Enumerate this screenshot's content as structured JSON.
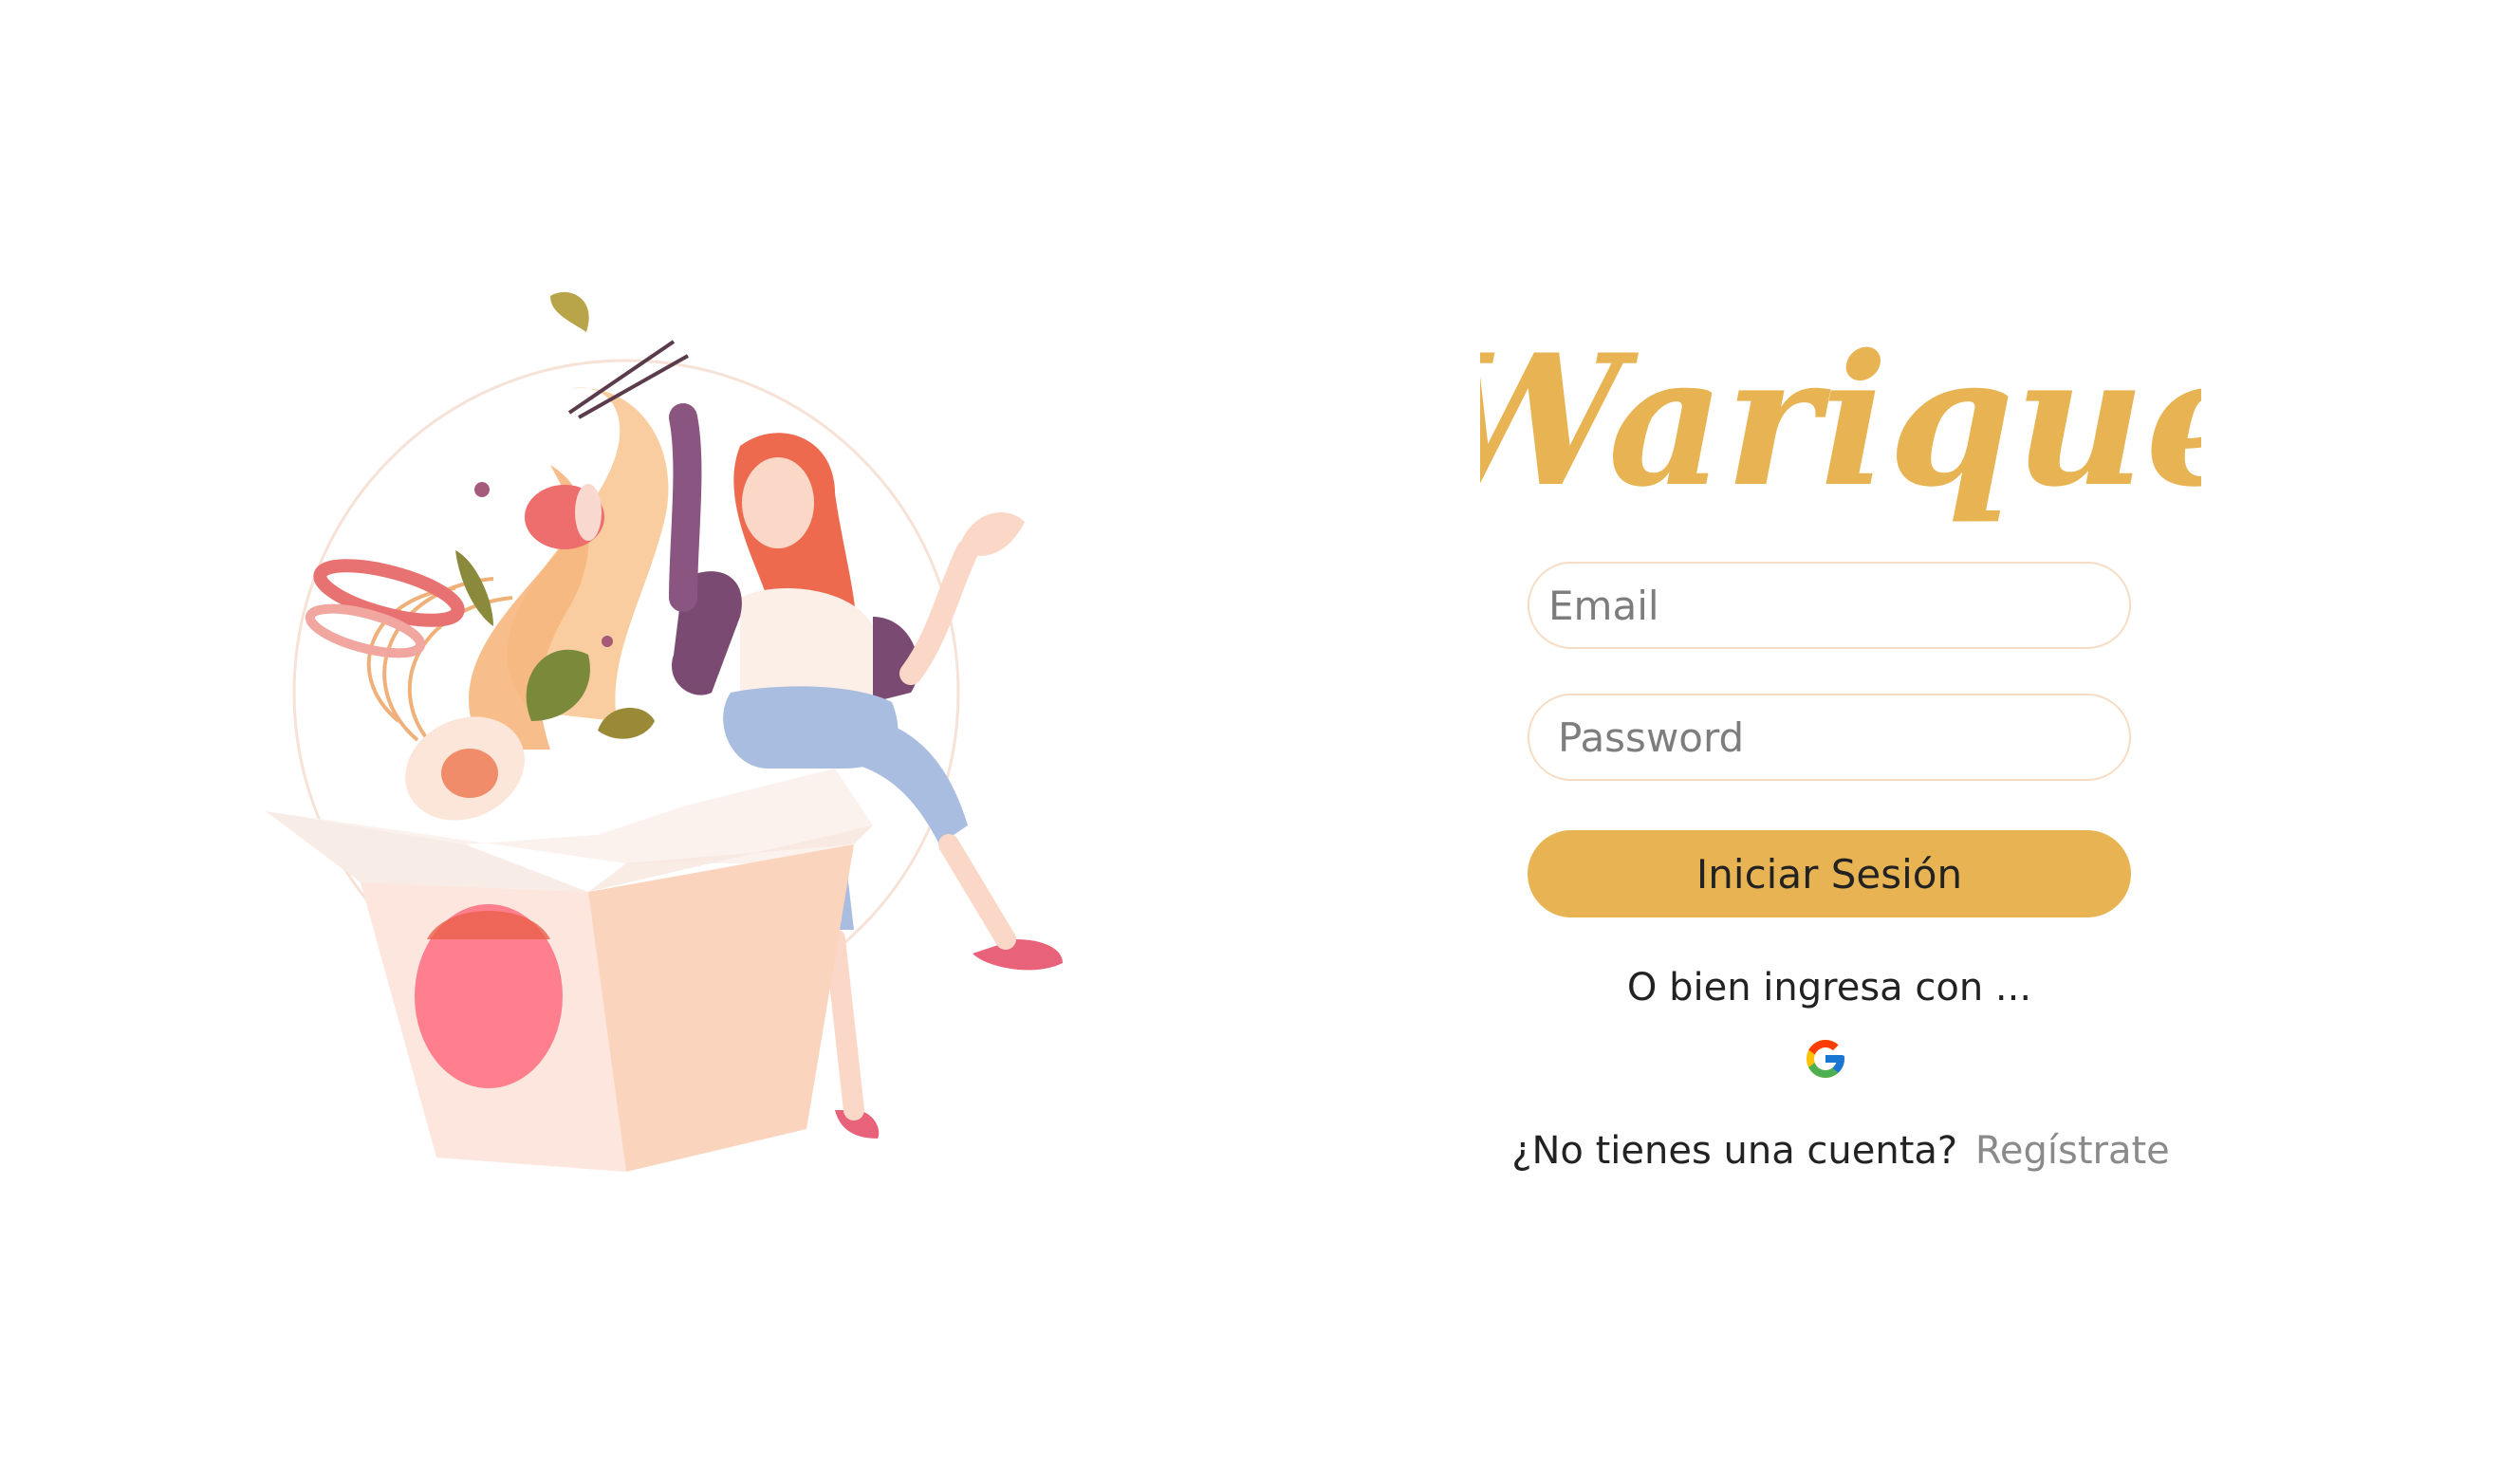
{
  "brand": {
    "logo_text": "Warique",
    "logo_color": "#e8b453"
  },
  "form": {
    "email": {
      "placeholder": "Email",
      "value": ""
    },
    "password": {
      "placeholder": "Password",
      "value": ""
    },
    "login_button_label": "Iniciar Sesión",
    "login_button_color": "#e8b453",
    "alt_login_text": "O bien ingresa con ...",
    "google_icon": "google-icon"
  },
  "signup": {
    "prompt": "¿No tienes una cuenta?",
    "link_label": "Regístrate"
  },
  "illustration": {
    "icon": "woman-noodle-box-illustration"
  }
}
